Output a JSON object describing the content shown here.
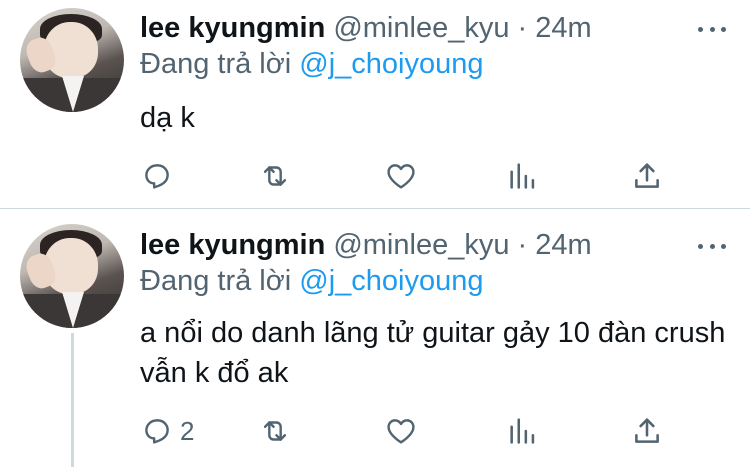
{
  "tweets": [
    {
      "author_name": "lee kyungmin",
      "handle_time": "@minlee_kyu · 24m",
      "reply_prefix": "Đang trả lời ",
      "reply_to": "@j_choiyoung",
      "text": "dạ k",
      "reply_count": ""
    },
    {
      "author_name": "lee kyungmin",
      "handle_time": "@minlee_kyu · 24m",
      "reply_prefix": "Đang trả lời ",
      "reply_to": "@j_choiyoung",
      "text": "a nổi do danh lãng tử guitar gảy 10 đàn crush vẫn k đổ ak",
      "reply_count": "2"
    }
  ],
  "icons": {
    "reply": "reply-icon",
    "retweet": "retweet-icon",
    "like": "heart-icon",
    "stats": "stats-icon",
    "share": "share-icon",
    "more": "more-icon"
  },
  "colors": {
    "text": "#0f1419",
    "secondary": "#536471",
    "accent": "#1d9bf0",
    "divider": "#cfd9de"
  }
}
